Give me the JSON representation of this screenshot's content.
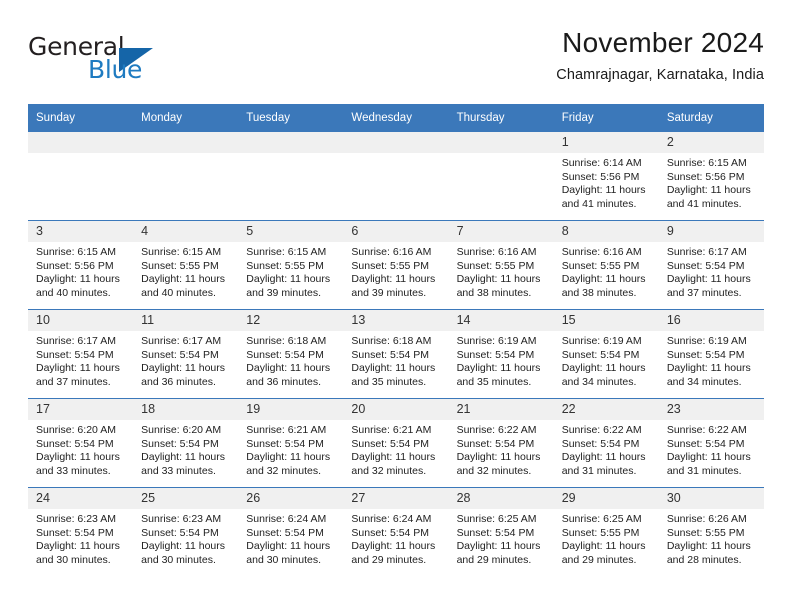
{
  "brand": {
    "name_top": "General",
    "name_bottom": "Blue",
    "accent_color": "#1f7bc1",
    "triangle_color": "#1565a8"
  },
  "header": {
    "title": "November 2024",
    "subtitle": "Chamrajnagar, Karnataka, India"
  },
  "calendar": {
    "header_bg": "#3b78ba",
    "daynum_bg": "#f0f0f0",
    "weekdays": [
      "Sunday",
      "Monday",
      "Tuesday",
      "Wednesday",
      "Thursday",
      "Friday",
      "Saturday"
    ],
    "weeks": [
      [
        {
          "day": "",
          "sunrise": "",
          "sunset": "",
          "daylight": ""
        },
        {
          "day": "",
          "sunrise": "",
          "sunset": "",
          "daylight": ""
        },
        {
          "day": "",
          "sunrise": "",
          "sunset": "",
          "daylight": ""
        },
        {
          "day": "",
          "sunrise": "",
          "sunset": "",
          "daylight": ""
        },
        {
          "day": "",
          "sunrise": "",
          "sunset": "",
          "daylight": ""
        },
        {
          "day": "1",
          "sunrise": "Sunrise: 6:14 AM",
          "sunset": "Sunset: 5:56 PM",
          "daylight": "Daylight: 11 hours and 41 minutes."
        },
        {
          "day": "2",
          "sunrise": "Sunrise: 6:15 AM",
          "sunset": "Sunset: 5:56 PM",
          "daylight": "Daylight: 11 hours and 41 minutes."
        }
      ],
      [
        {
          "day": "3",
          "sunrise": "Sunrise: 6:15 AM",
          "sunset": "Sunset: 5:56 PM",
          "daylight": "Daylight: 11 hours and 40 minutes."
        },
        {
          "day": "4",
          "sunrise": "Sunrise: 6:15 AM",
          "sunset": "Sunset: 5:55 PM",
          "daylight": "Daylight: 11 hours and 40 minutes."
        },
        {
          "day": "5",
          "sunrise": "Sunrise: 6:15 AM",
          "sunset": "Sunset: 5:55 PM",
          "daylight": "Daylight: 11 hours and 39 minutes."
        },
        {
          "day": "6",
          "sunrise": "Sunrise: 6:16 AM",
          "sunset": "Sunset: 5:55 PM",
          "daylight": "Daylight: 11 hours and 39 minutes."
        },
        {
          "day": "7",
          "sunrise": "Sunrise: 6:16 AM",
          "sunset": "Sunset: 5:55 PM",
          "daylight": "Daylight: 11 hours and 38 minutes."
        },
        {
          "day": "8",
          "sunrise": "Sunrise: 6:16 AM",
          "sunset": "Sunset: 5:55 PM",
          "daylight": "Daylight: 11 hours and 38 minutes."
        },
        {
          "day": "9",
          "sunrise": "Sunrise: 6:17 AM",
          "sunset": "Sunset: 5:54 PM",
          "daylight": "Daylight: 11 hours and 37 minutes."
        }
      ],
      [
        {
          "day": "10",
          "sunrise": "Sunrise: 6:17 AM",
          "sunset": "Sunset: 5:54 PM",
          "daylight": "Daylight: 11 hours and 37 minutes."
        },
        {
          "day": "11",
          "sunrise": "Sunrise: 6:17 AM",
          "sunset": "Sunset: 5:54 PM",
          "daylight": "Daylight: 11 hours and 36 minutes."
        },
        {
          "day": "12",
          "sunrise": "Sunrise: 6:18 AM",
          "sunset": "Sunset: 5:54 PM",
          "daylight": "Daylight: 11 hours and 36 minutes."
        },
        {
          "day": "13",
          "sunrise": "Sunrise: 6:18 AM",
          "sunset": "Sunset: 5:54 PM",
          "daylight": "Daylight: 11 hours and 35 minutes."
        },
        {
          "day": "14",
          "sunrise": "Sunrise: 6:19 AM",
          "sunset": "Sunset: 5:54 PM",
          "daylight": "Daylight: 11 hours and 35 minutes."
        },
        {
          "day": "15",
          "sunrise": "Sunrise: 6:19 AM",
          "sunset": "Sunset: 5:54 PM",
          "daylight": "Daylight: 11 hours and 34 minutes."
        },
        {
          "day": "16",
          "sunrise": "Sunrise: 6:19 AM",
          "sunset": "Sunset: 5:54 PM",
          "daylight": "Daylight: 11 hours and 34 minutes."
        }
      ],
      [
        {
          "day": "17",
          "sunrise": "Sunrise: 6:20 AM",
          "sunset": "Sunset: 5:54 PM",
          "daylight": "Daylight: 11 hours and 33 minutes."
        },
        {
          "day": "18",
          "sunrise": "Sunrise: 6:20 AM",
          "sunset": "Sunset: 5:54 PM",
          "daylight": "Daylight: 11 hours and 33 minutes."
        },
        {
          "day": "19",
          "sunrise": "Sunrise: 6:21 AM",
          "sunset": "Sunset: 5:54 PM",
          "daylight": "Daylight: 11 hours and 32 minutes."
        },
        {
          "day": "20",
          "sunrise": "Sunrise: 6:21 AM",
          "sunset": "Sunset: 5:54 PM",
          "daylight": "Daylight: 11 hours and 32 minutes."
        },
        {
          "day": "21",
          "sunrise": "Sunrise: 6:22 AM",
          "sunset": "Sunset: 5:54 PM",
          "daylight": "Daylight: 11 hours and 32 minutes."
        },
        {
          "day": "22",
          "sunrise": "Sunrise: 6:22 AM",
          "sunset": "Sunset: 5:54 PM",
          "daylight": "Daylight: 11 hours and 31 minutes."
        },
        {
          "day": "23",
          "sunrise": "Sunrise: 6:22 AM",
          "sunset": "Sunset: 5:54 PM",
          "daylight": "Daylight: 11 hours and 31 minutes."
        }
      ],
      [
        {
          "day": "24",
          "sunrise": "Sunrise: 6:23 AM",
          "sunset": "Sunset: 5:54 PM",
          "daylight": "Daylight: 11 hours and 30 minutes."
        },
        {
          "day": "25",
          "sunrise": "Sunrise: 6:23 AM",
          "sunset": "Sunset: 5:54 PM",
          "daylight": "Daylight: 11 hours and 30 minutes."
        },
        {
          "day": "26",
          "sunrise": "Sunrise: 6:24 AM",
          "sunset": "Sunset: 5:54 PM",
          "daylight": "Daylight: 11 hours and 30 minutes."
        },
        {
          "day": "27",
          "sunrise": "Sunrise: 6:24 AM",
          "sunset": "Sunset: 5:54 PM",
          "daylight": "Daylight: 11 hours and 29 minutes."
        },
        {
          "day": "28",
          "sunrise": "Sunrise: 6:25 AM",
          "sunset": "Sunset: 5:54 PM",
          "daylight": "Daylight: 11 hours and 29 minutes."
        },
        {
          "day": "29",
          "sunrise": "Sunrise: 6:25 AM",
          "sunset": "Sunset: 5:55 PM",
          "daylight": "Daylight: 11 hours and 29 minutes."
        },
        {
          "day": "30",
          "sunrise": "Sunrise: 6:26 AM",
          "sunset": "Sunset: 5:55 PM",
          "daylight": "Daylight: 11 hours and 28 minutes."
        }
      ]
    ]
  }
}
